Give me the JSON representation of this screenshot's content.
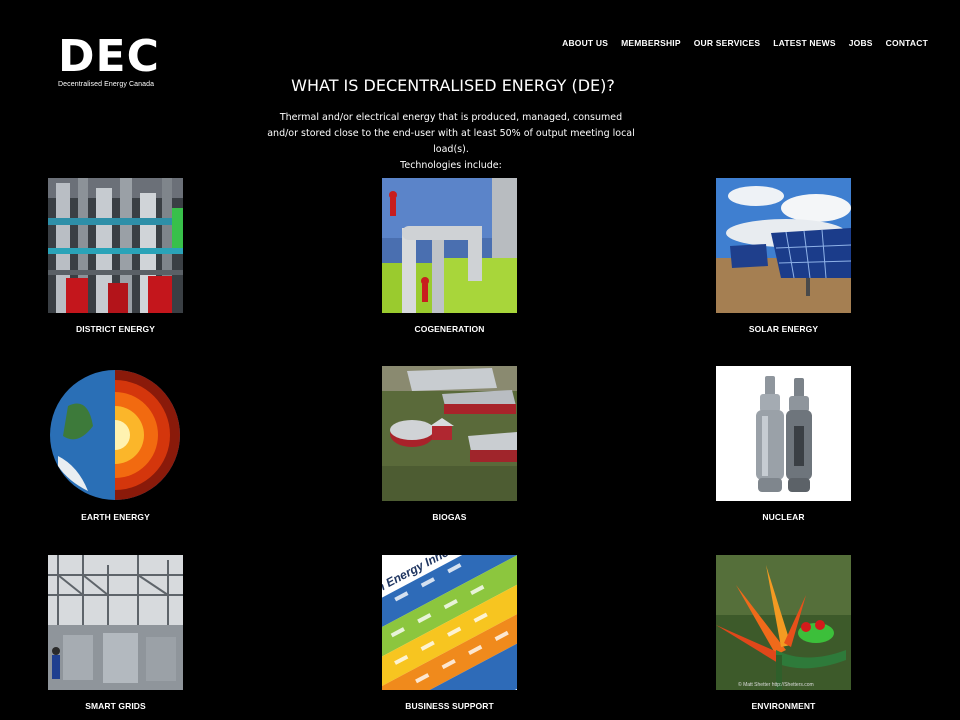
{
  "logo": {
    "text": "DEC",
    "subtitle": "Decentralised Energy Canada"
  },
  "nav": {
    "items": [
      "ABOUT US",
      "MEMBERSHIP",
      "OUR SERVICES",
      "LATEST NEWS",
      "JOBS",
      "CONTACT"
    ]
  },
  "hero": {
    "title": "WHAT IS DECENTRALISED ENERGY (DE)?",
    "description": "Thermal and/or electrical energy that is produced, managed, consumed and/or stored close to the end-user with at least 50% of output meeting local load(s).",
    "subline": "Technologies include:"
  },
  "technologies": [
    {
      "label": "DISTRICT ENERGY",
      "icon": "district-energy-image"
    },
    {
      "label": "COGENERATION",
      "icon": "cogeneration-image"
    },
    {
      "label": "SOLAR ENERGY",
      "icon": "solar-panels-image"
    },
    {
      "label": "EARTH ENERGY",
      "icon": "earth-cross-section-image"
    },
    {
      "label": "BIOGAS",
      "icon": "biogas-farm-image"
    },
    {
      "label": "NUCLEAR",
      "icon": "reactor-modules-image"
    },
    {
      "label": "SMART GRIDS",
      "icon": "substation-image"
    },
    {
      "label": "BUSINESS SUPPORT",
      "icon": "innovation-chart-image",
      "chart_heading": "Clean Energy Innovation Hu"
    },
    {
      "label": "ENVIRONMENT",
      "icon": "frog-flower-image",
      "watermark": "© Matt Shetter   http://Shetters.com"
    }
  ]
}
